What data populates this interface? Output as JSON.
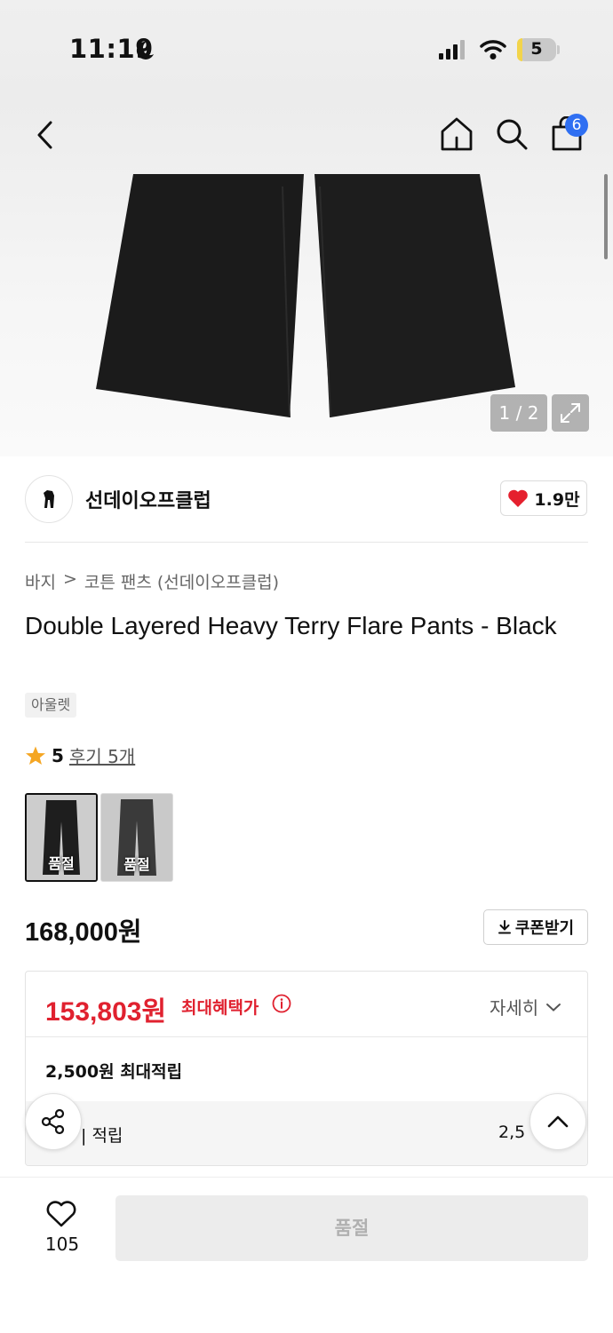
{
  "status_bar": {
    "time": "11:19",
    "battery": "5"
  },
  "nav": {
    "cart_count": "6"
  },
  "gallery": {
    "counter": "1 / 2"
  },
  "brand": {
    "name": "선데이오프클럽",
    "likes": "1.9만"
  },
  "breadcrumb": {
    "category": "바지",
    "separator": ">",
    "subcategory": "코튼 팬츠 (선데이오프클럽)"
  },
  "product": {
    "title": "Double Layered Heavy Terry Flare Pants - Black",
    "tag": "아울렛",
    "rating": "5",
    "review_text": "후기 5개",
    "price": "168,000원"
  },
  "variants": [
    {
      "label": "품절",
      "selected": true,
      "color": "#1e1e1e"
    },
    {
      "label": "품절",
      "selected": false,
      "color": "#3a3a3a"
    }
  ],
  "coupon": {
    "label": "쿠폰받기"
  },
  "benefit": {
    "sale_price": "153,803원",
    "max_label": "최대혜택가",
    "detail_label": "자세히",
    "points_label": "2,500원 최대적립",
    "sub_left": "| 적립",
    "sub_right": "2,5"
  },
  "bottom": {
    "wish_count": "105",
    "soldout_label": "품절"
  },
  "colors": {
    "accent_red": "#e0212f",
    "badge_blue": "#2f6ff2",
    "heart_red": "#e5202e",
    "star": "#f5a623"
  }
}
